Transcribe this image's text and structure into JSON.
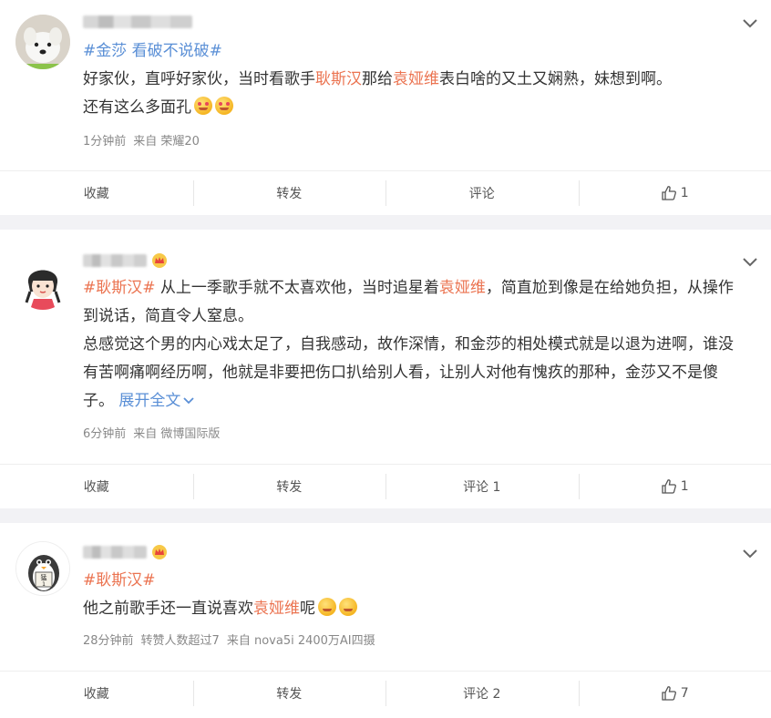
{
  "posts": [
    {
      "topic": "#金莎 看破不说破#",
      "line1_pre": "好家伙，直呼好家伙，当时看歌手",
      "line1_hl1": "耿斯汉",
      "line1_mid": "那给",
      "line1_hl2": "袁娅维",
      "line1_post": "表白啥的又土又娴熟，妹想到啊。",
      "line2": "还有这么多面孔",
      "meta_time": "1分钟前",
      "meta_source": "来自 荣耀20",
      "actions": {
        "collect": "收藏",
        "forward": "转发",
        "comment": "评论",
        "like": "1"
      }
    },
    {
      "topic": "#耿斯汉#",
      "p1_pre": " 从上一季歌手就不太喜欢他，当时追星着",
      "p1_hl": "袁娅维",
      "p1_post": "，简直尬到像是在给她负担，从操作到说话，简直令人窒息。",
      "p2": "总感觉这个男的内心戏太足了，自我感动，故作深情，和金莎的相处模式就是以退为进啊，谁没有苦啊痛啊经历啊，他就是非要把伤口扒给别人看，让别人对他有愧疚的那种，金莎又不是傻子。",
      "expand": "展开全文",
      "meta_time": "6分钟前",
      "meta_source": "来自 微博国际版",
      "actions": {
        "collect": "收藏",
        "forward": "转发",
        "comment": "评论 1",
        "like": "1"
      }
    },
    {
      "topic": "#耿斯汉#",
      "line_pre": "他之前歌手还一直说喜欢",
      "line_hl": "袁娅维",
      "line_post": "呢",
      "avatar_text": "猛\n1",
      "meta_time": "28分钟前",
      "meta_extra": "转赞人数超过7",
      "meta_source": "来自 nova5i 2400万AI四摄",
      "actions": {
        "collect": "收藏",
        "forward": "转发",
        "comment": "评论 2",
        "like": "7"
      }
    }
  ],
  "colors": {
    "topic_orange": "#eb7350",
    "topic_blue": "#5a8fd6",
    "link_blue": "#5a8fd6"
  }
}
